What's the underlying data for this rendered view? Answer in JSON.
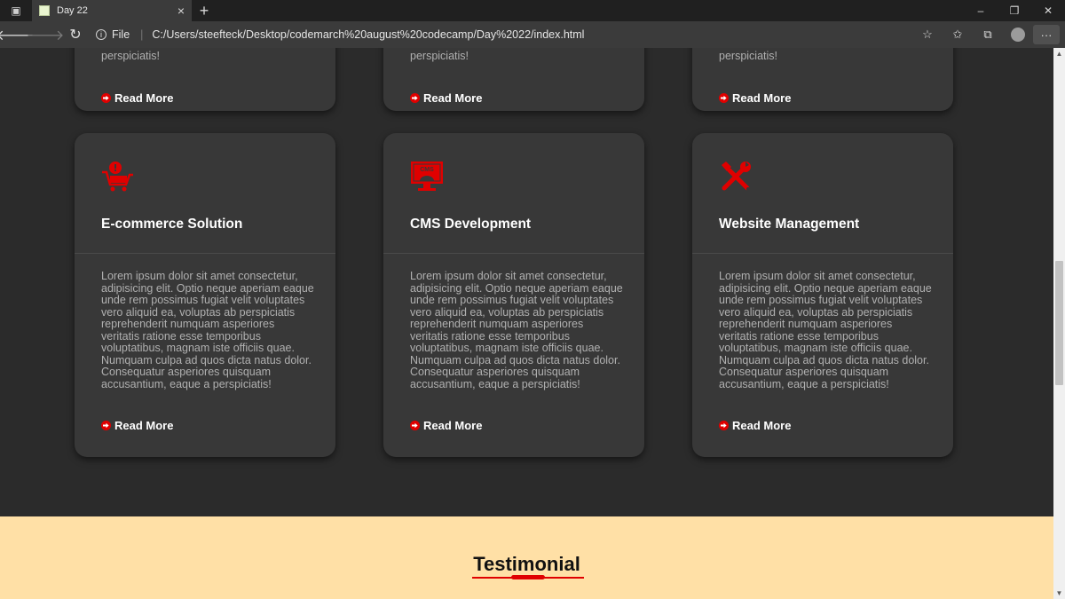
{
  "browser": {
    "tab_title": "Day 22",
    "tab_close": "×",
    "new_tab": "+",
    "address_scheme": "File",
    "address_url": "C:/Users/steefteck/Desktop/codemarch%20august%20codecamp/Day%2022/index.html",
    "window_controls": [
      "–",
      "❐",
      "✕"
    ],
    "more": "···"
  },
  "colors": {
    "accent": "#e00000",
    "card_bg": "#383838",
    "page_bg": "#2b2b2b",
    "testimonial_bg": "#ffe0a6"
  },
  "services_top": [
    {
      "tail": "perspiciatis!",
      "read_more": "Read More"
    },
    {
      "tail": "perspiciatis!",
      "read_more": "Read More"
    },
    {
      "tail": "perspiciatis!",
      "read_more": "Read More"
    }
  ],
  "services": [
    {
      "icon": "shopping-cart-icon",
      "title": "E-commerce Solution",
      "description": "Lorem ipsum dolor sit amet consectetur, adipisicing elit. Optio neque aperiam eaque unde rem possimus fugiat velit voluptates vero aliquid ea, voluptas ab perspiciatis reprehenderit numquam asperiores veritatis ratione esse temporibus voluptatibus, magnam iste officiis quae. Numquam culpa ad quos dicta natus dolor. Consequatur asperiores quisquam accusantium, eaque a perspiciatis!",
      "read_more": "Read More"
    },
    {
      "icon": "cms-monitor-icon",
      "icon_text": "CMS",
      "title": "CMS Development",
      "description": "Lorem ipsum dolor sit amet consectetur, adipisicing elit. Optio neque aperiam eaque unde rem possimus fugiat velit voluptates vero aliquid ea, voluptas ab perspiciatis reprehenderit numquam asperiores veritatis ratione esse temporibus voluptatibus, magnam iste officiis quae. Numquam culpa ad quos dicta natus dolor. Consequatur asperiores quisquam accusantium, eaque a perspiciatis!",
      "read_more": "Read More"
    },
    {
      "icon": "tools-icon",
      "title": "Website Management",
      "description": "Lorem ipsum dolor sit amet consectetur, adipisicing elit. Optio neque aperiam eaque unde rem possimus fugiat velit voluptates vero aliquid ea, voluptas ab perspiciatis reprehenderit numquam asperiores veritatis ratione esse temporibus voluptatibus, magnam iste officiis quae. Numquam culpa ad quos dicta natus dolor. Consequatur asperiores quisquam accusantium, eaque a perspiciatis!",
      "read_more": "Read More"
    }
  ],
  "testimonial": {
    "title": "Testimonial"
  }
}
